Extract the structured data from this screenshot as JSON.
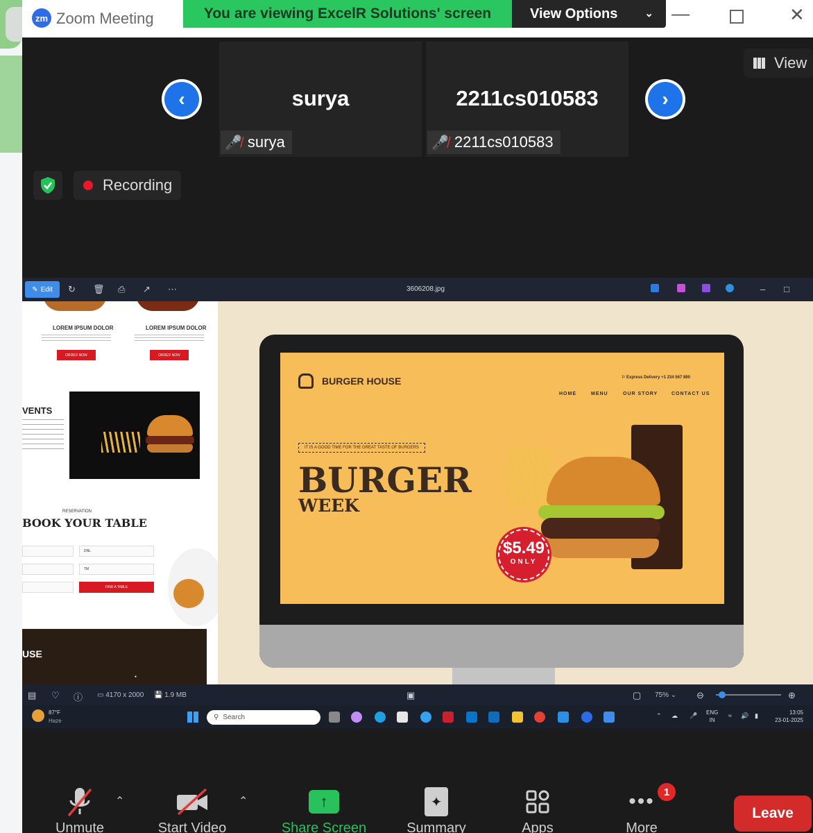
{
  "window": {
    "app_name": "Zoom Meeting",
    "logo_text": "zm"
  },
  "share_banner": {
    "text": "You are viewing ExcelR Solutions' screen"
  },
  "view_options": {
    "label": "View Options"
  },
  "view_button": {
    "label": "View"
  },
  "participants": [
    {
      "display_name": "surya",
      "name_tag": "surya",
      "muted": true
    },
    {
      "display_name": "2211cs010583",
      "name_tag": "2211cs010583",
      "muted": true
    }
  ],
  "recording": {
    "label": "Recording"
  },
  "photo_viewer": {
    "edit_label": "Edit",
    "file_name": "3606208.jpg",
    "image_dims": "4170 x 2000",
    "file_size": "1.9 MB",
    "zoom_level": "75%",
    "zoom_fraction": 0.1
  },
  "website_left": {
    "lorem_1": "LOREM IPSUM DOLOR",
    "lorem_2": "LOREM IPSUM DOLOR",
    "order_btn_1": "ORDER NOW",
    "order_btn_2": "ORDER NOW",
    "events_heading": "VENTS",
    "reservation_label": "RESERVATION",
    "book_heading": "BOOK YOUR TABLE",
    "field_dnl": "DNL",
    "field_tm": "TM",
    "find_button": "FIND A TABLE",
    "use_heading": "USE"
  },
  "burger_screen": {
    "brand": "BURGER HOUSE",
    "delivery": "Express Delivery +1 234 567 890",
    "nav": [
      "HOME",
      "MENU",
      "OUR STORY",
      "CONTACT US"
    ],
    "tagline": "IT IS A GOOD TIME FOR THE GREAT TASTE OF BURGERS",
    "headline": "BURGER",
    "subheadline": "WEEK",
    "price": "$5.49",
    "price_note": "ONLY"
  },
  "taskbar": {
    "weather_temp": "87°F",
    "weather_desc": "Haze",
    "search_placeholder": "Search",
    "lang_1": "ENG",
    "lang_2": "IN",
    "time": "13:05",
    "date": "23-01-2025"
  },
  "toolbar": {
    "unmute": "Unmute",
    "start_video": "Start Video",
    "share_screen": "Share Screen",
    "summary": "Summary",
    "apps": "Apps",
    "more": "More",
    "more_badge": "1",
    "leave": "Leave"
  },
  "colors": {
    "share_green": "#2ac65f",
    "zoom_blue": "#1f73e8",
    "leave_red": "#d32a2a",
    "record_red": "#e6192b",
    "burger_bg": "#f7bd59"
  }
}
